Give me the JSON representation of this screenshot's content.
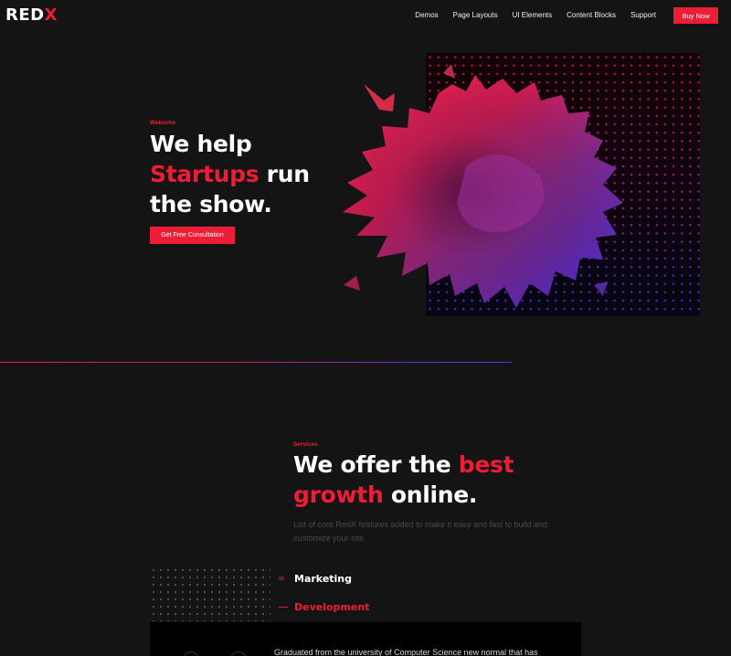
{
  "brand": {
    "logo_white": "RED",
    "logo_red": "X"
  },
  "nav": {
    "items": [
      "Demos",
      "Page Layouts",
      "UI Elements",
      "Content Blocks",
      "Support"
    ],
    "buy_label": "Buy Now"
  },
  "hero": {
    "eyebrow": "Welcome",
    "title_line1": "We help",
    "title_red": "Startups",
    "title_line2_rest": " run",
    "title_line3": "the show.",
    "cta_label": "Get Free Consultation"
  },
  "services": {
    "eyebrow": "Services",
    "title_part1": "We offer the ",
    "title_red1": "best",
    "title_red2": "growth",
    "title_part2": " online.",
    "description": "List of core RedX features added to make it easy and fast to build and customize your site.",
    "items": [
      {
        "number": "01",
        "label": "Marketing",
        "active": false
      },
      {
        "label": "Development",
        "active": true
      }
    ],
    "panel_text": "Graduated from the university of Computer Science new normal that has"
  },
  "colors": {
    "accent": "#ee1d36",
    "background": "#141414",
    "panel": "#000000"
  }
}
